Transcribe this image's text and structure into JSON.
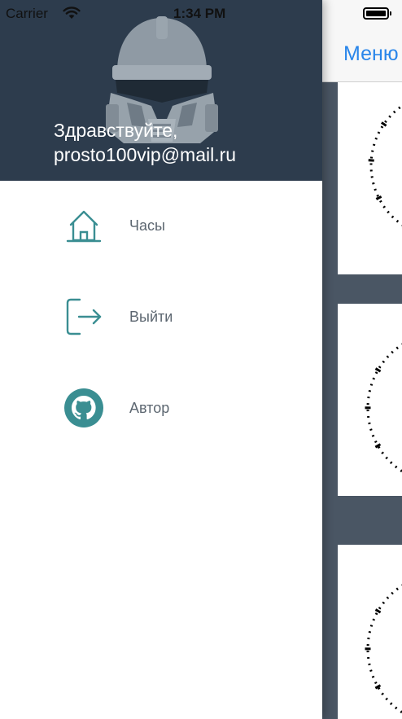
{
  "status_bar": {
    "carrier": "Carrier",
    "time": "1:34 PM"
  },
  "drawer": {
    "header": {
      "greeting_line1": "Здравствуйте,",
      "greeting_line2": "prosto100vip@mail.ru"
    },
    "items": [
      {
        "label": "Часы",
        "icon": "home-icon"
      },
      {
        "label": "Выйти",
        "icon": "logout-icon"
      },
      {
        "label": "Автор",
        "icon": "github-icon"
      }
    ]
  },
  "main": {
    "nav": {
      "menu_label": "Меню"
    }
  },
  "colors": {
    "drawer_header_bg": "#2d3c4d",
    "icon_teal": "#3a8e92",
    "link_blue": "#2a86ea",
    "list_bg": "#4a5664"
  }
}
